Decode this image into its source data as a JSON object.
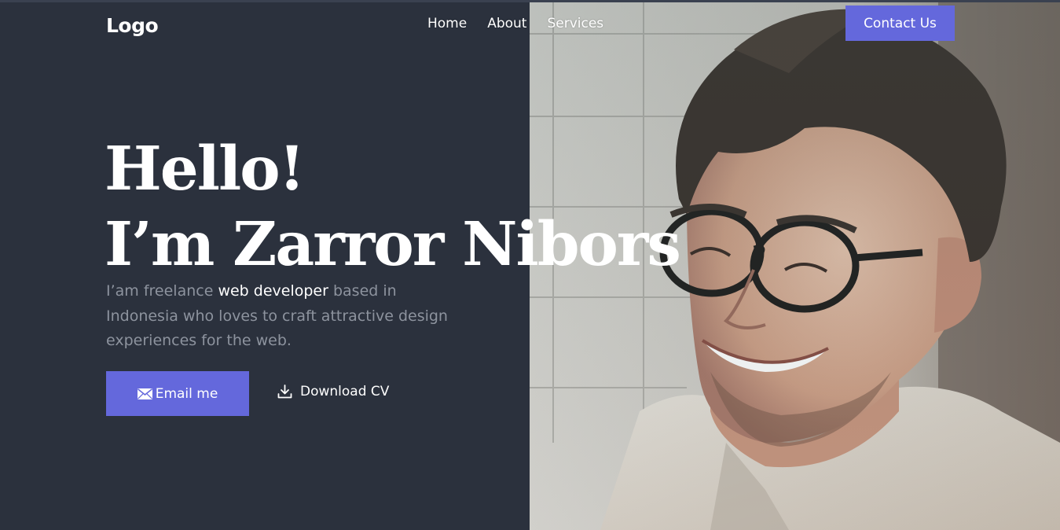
{
  "header": {
    "logo": "Logo",
    "nav": [
      {
        "label": "Home"
      },
      {
        "label": "About"
      },
      {
        "label": "Services"
      }
    ],
    "contact_label": "Contact Us"
  },
  "hero": {
    "title_line1": "Hello!",
    "title_line2": "I’m Zarror Nibors",
    "desc_part1": "I’am freelance ",
    "desc_highlight": "web developer",
    "desc_part2": " based in Indonesia who loves to craft attractive design experiences for the web.",
    "email_label": "Email me",
    "download_label": "Download CV"
  },
  "icons": {
    "email": "envelope-icon",
    "download": "download-icon"
  },
  "colors": {
    "background": "#2b313d",
    "accent": "#6468dc",
    "text": "#ffffff",
    "muted": "#8d939e"
  }
}
